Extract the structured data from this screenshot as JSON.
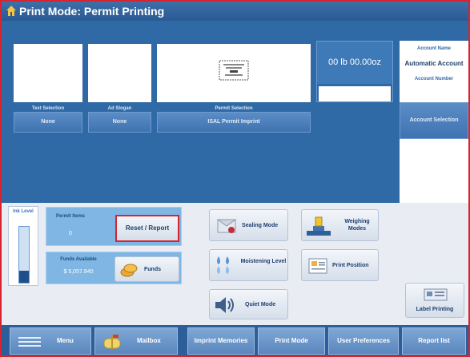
{
  "title": "Print Mode: Permit Printing",
  "top": {
    "text_selection": {
      "caption": "Text Selection",
      "value": "None"
    },
    "ad_slogan": {
      "caption": "Ad Slogan",
      "value": "None"
    },
    "permit_selection": {
      "caption": "Permit Selection",
      "value": "ISAL Permit Imprint"
    },
    "weight": "00 lb 00.00oz",
    "account": {
      "name_label": "Account Name",
      "name": "Automatic Account",
      "number_label": "Account Number",
      "button": "Account Selection"
    }
  },
  "ink": {
    "label": "Ink Level",
    "level_fraction": 0.22
  },
  "permit_items": {
    "label": "Permit Items",
    "value": "0"
  },
  "funds_available": {
    "label": "Funds Available",
    "value": "$ 5,057.940"
  },
  "buttons": {
    "reset_report": "Reset / Report",
    "funds": "Funds",
    "sealing_mode": "Sealing Mode",
    "weighing_modes": "Weighing Modes",
    "moistening_level": "Moistening Level",
    "print_position": "Print Position",
    "quiet_mode": "Quiet Mode",
    "label_printing": "Label Printing"
  },
  "nav": [
    "Menu",
    "Mailbox",
    "Imprint Memories",
    "Print Mode",
    "User Preferences",
    "Report list"
  ],
  "colors": {
    "accent": "#2f69a6",
    "highlight": "#d8242f"
  }
}
